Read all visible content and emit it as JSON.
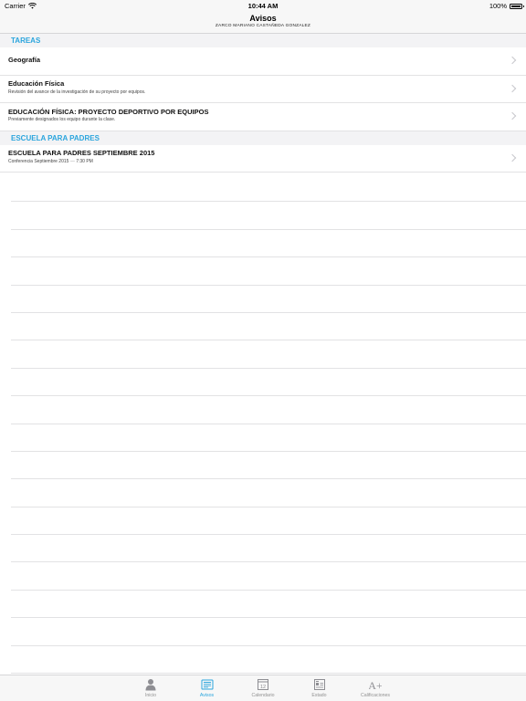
{
  "status_bar": {
    "carrier": "Carrier",
    "time": "10:44 AM",
    "battery": "100%"
  },
  "nav": {
    "title": "Avisos",
    "subtitle": "ZARCO MARIANO CASTAÑEDA GONZALEZ"
  },
  "sections": [
    {
      "header": "TAREAS",
      "rows": [
        {
          "title": "Geografía",
          "subtitle": ""
        },
        {
          "title": "Educación Física",
          "subtitle": "Revisión del avance de la investigación de su proyecto por equipos."
        },
        {
          "title": "EDUCACIÓN FÍSICA: PROYECTO DEPORTIVO POR EQUIPOS",
          "subtitle": "Previamente designados los equipo durante la clase."
        }
      ]
    },
    {
      "header": "ESCUELA PARA PADRES",
      "rows": [
        {
          "title": "ESCUELA PARA PADRES SEPTIEMBRE 2015",
          "subtitle_left": "Conferencia Septiembre 2015",
          "subtitle_sep": "—",
          "subtitle_right": "7:30 PM"
        }
      ]
    }
  ],
  "tabs": [
    {
      "label": "Inicio",
      "icon": "person-icon",
      "active": false
    },
    {
      "label": "Avisos",
      "icon": "newspaper-icon",
      "active": true
    },
    {
      "label": "Calendario",
      "icon": "calendar-icon",
      "day": "12",
      "active": false
    },
    {
      "label": "Estado",
      "icon": "report-icon",
      "active": false
    },
    {
      "label": "Calificaciones",
      "icon": "grade-icon",
      "glyph": "A+",
      "active": false
    }
  ],
  "colors": {
    "accent": "#2ba5dd",
    "inactive_tab": "#929292",
    "section_bg": "#f3f3f5"
  }
}
